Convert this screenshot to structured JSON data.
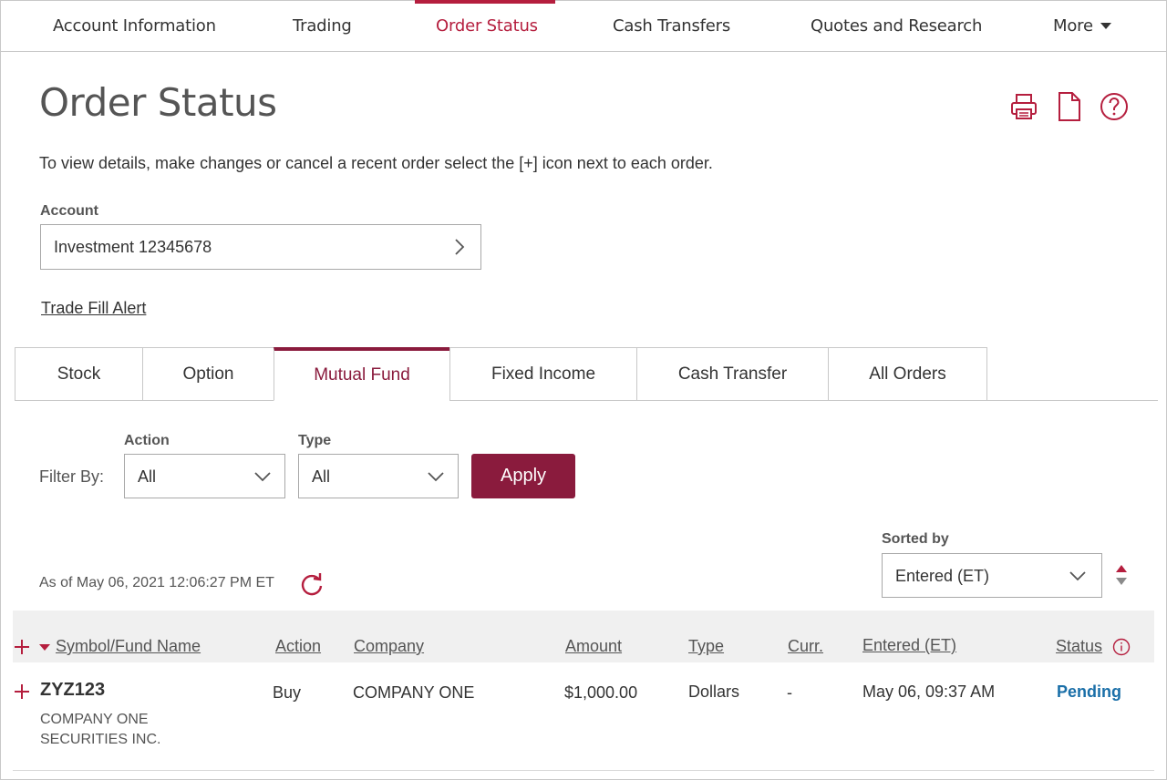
{
  "nav": {
    "items": [
      {
        "label": "Account Information"
      },
      {
        "label": "Trading"
      },
      {
        "label": "Order Status",
        "active": true
      },
      {
        "label": "Cash Transfers"
      },
      {
        "label": "Quotes and Research"
      },
      {
        "label": "More"
      }
    ],
    "accent_color": "#b51e3e"
  },
  "header": {
    "title": "Order Status",
    "icons": [
      "print-icon",
      "document-icon",
      "help-icon"
    ],
    "instructions": "To view details, make changes or cancel a recent order select the [+] icon next to each order."
  },
  "account": {
    "label": "Account",
    "value": "Investment 12345678"
  },
  "trade_fill_alert": "Trade Fill Alert",
  "tabs": [
    {
      "label": "Stock"
    },
    {
      "label": "Option"
    },
    {
      "label": "Mutual Fund",
      "active": true
    },
    {
      "label": "Fixed Income"
    },
    {
      "label": "Cash Transfer"
    },
    {
      "label": "All Orders"
    }
  ],
  "filters": {
    "filter_by_label": "Filter By:",
    "action_label": "Action",
    "action_value": "All",
    "type_label": "Type",
    "type_value": "All",
    "apply_label": "Apply",
    "button_color": "#8a1b3d"
  },
  "as_of": "As of May 06, 2021 12:06:27 PM ET",
  "sort": {
    "label": "Sorted by",
    "value": "Entered (ET)"
  },
  "table": {
    "columns": {
      "symbol": "Symbol/Fund Name",
      "action": "Action",
      "company": "Company",
      "amount": "Amount",
      "type": "Type",
      "curr": "Curr.",
      "entered": "Entered (ET)",
      "status": "Status"
    },
    "rows": [
      {
        "symbol": "ZYZ123",
        "fund_name": "COMPANY ONE SECURITIES INC.",
        "action": "Buy",
        "company": "COMPANY ONE",
        "amount": "$1,000.00",
        "type": "Dollars",
        "curr": "-",
        "entered": "May 06, 09:37 AM",
        "status": "Pending",
        "status_color": "#1a6fa8"
      }
    ]
  }
}
